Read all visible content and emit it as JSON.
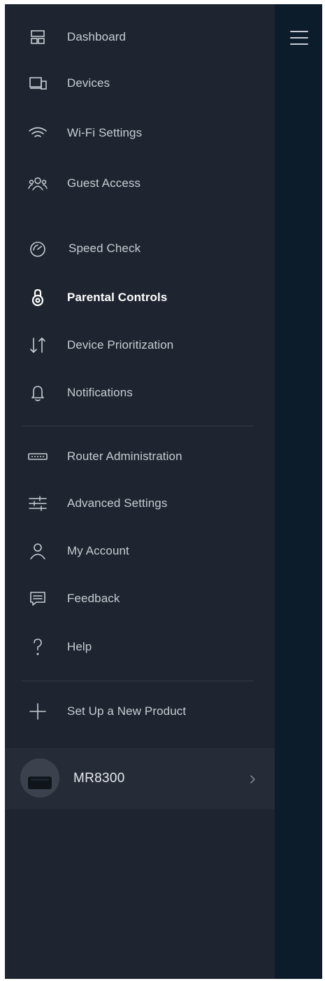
{
  "menu": {
    "items": [
      {
        "label": "Dashboard",
        "icon": "dashboard-icon"
      },
      {
        "label": "Devices",
        "icon": "devices-icon"
      },
      {
        "label": "Wi-Fi Settings",
        "icon": "wifi-icon"
      },
      {
        "label": "Guest Access",
        "icon": "guest-access-icon"
      },
      {
        "label": "Speed Check",
        "icon": "speedometer-icon"
      },
      {
        "label": "Parental Controls",
        "icon": "padlock-icon",
        "active": true
      },
      {
        "label": "Device Prioritization",
        "icon": "prioritization-arrows-icon"
      },
      {
        "label": "Notifications",
        "icon": "bell-icon"
      },
      {
        "label": "Router Administration",
        "icon": "router-icon"
      },
      {
        "label": "Advanced Settings",
        "icon": "sliders-icon"
      },
      {
        "label": "My Account",
        "icon": "user-icon"
      },
      {
        "label": "Feedback",
        "icon": "feedback-chat-icon"
      },
      {
        "label": "Help",
        "icon": "question-mark-icon"
      },
      {
        "label": "Set Up a New Product",
        "icon": "plus-icon"
      }
    ]
  },
  "device": {
    "name": "MR8300",
    "icon": "router-avatar-icon"
  },
  "colors": {
    "sidebar_bg": "#1f2530",
    "right_panel_bg": "#0d1c2b",
    "text": "#c7ccd3",
    "active_text": "#ffffff",
    "device_row_bg": "#262c37"
  }
}
